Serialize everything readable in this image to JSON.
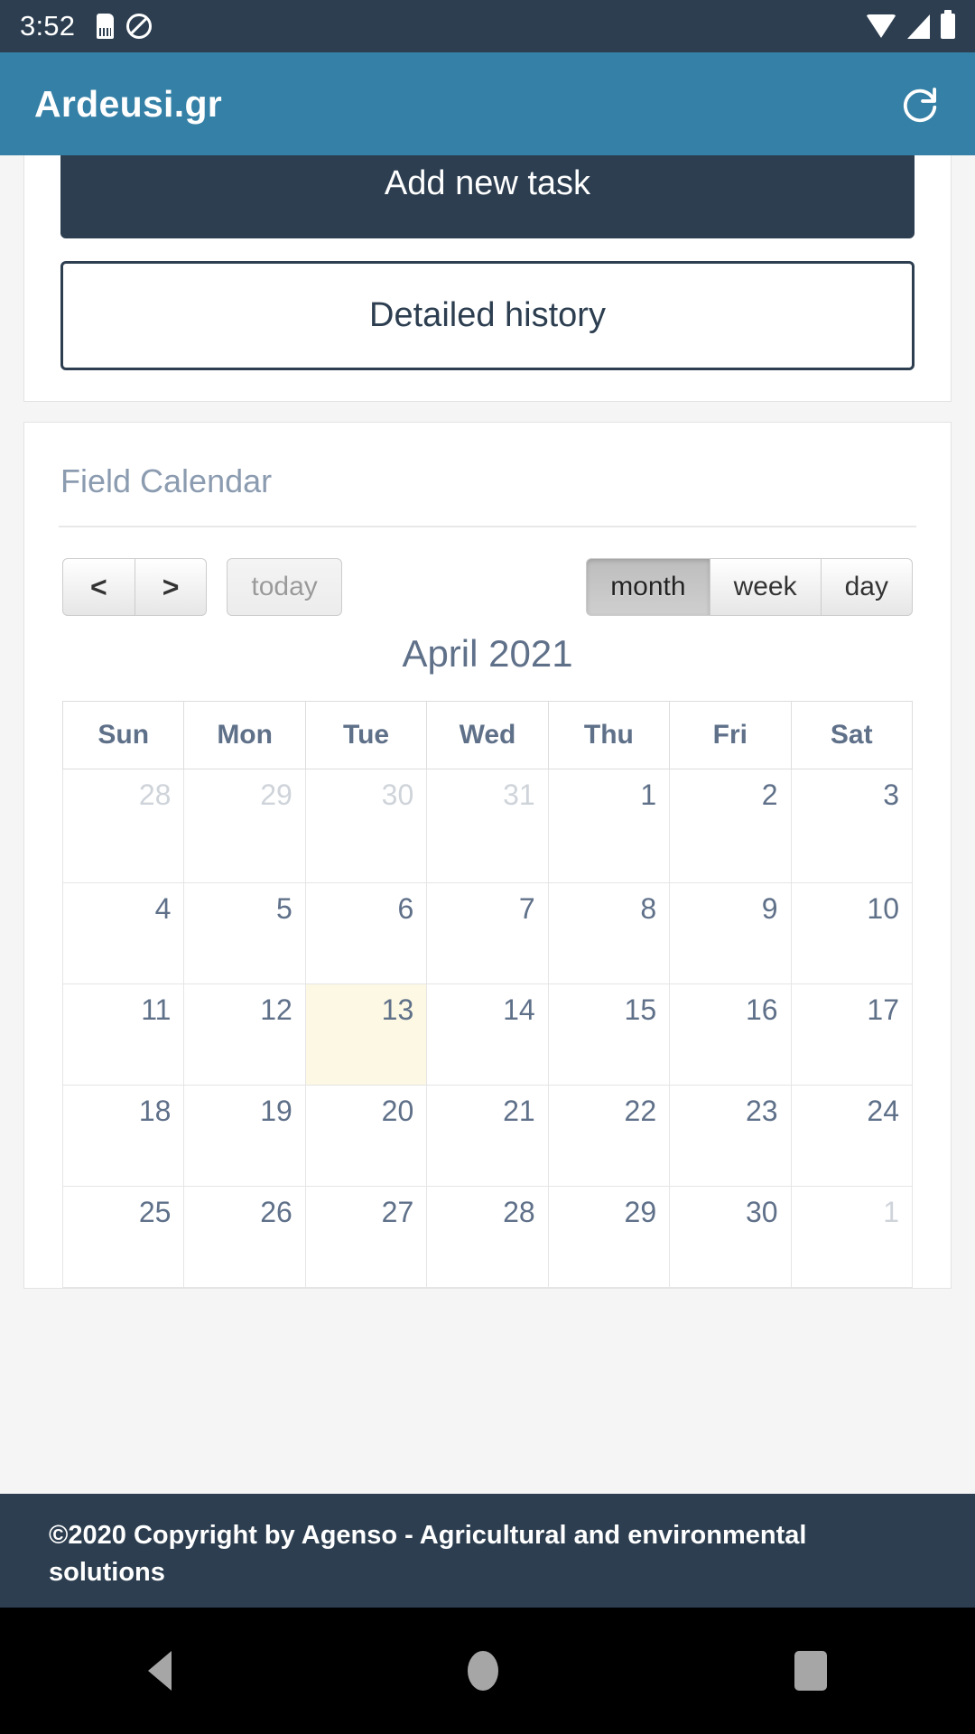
{
  "statusbar": {
    "time": "3:52",
    "icons_left": [
      "sdcard-icon",
      "do-not-disturb-icon"
    ],
    "icons_right": [
      "wifi-icon",
      "cellular-signal-icon",
      "battery-icon"
    ]
  },
  "appbar": {
    "title": "Ardeusi.gr",
    "refresh_icon": "refresh-icon"
  },
  "actions": {
    "add_task_label": "Add new task",
    "detailed_history_label": "Detailed history"
  },
  "calendar": {
    "heading": "Field Calendar",
    "toolbar": {
      "prev_label": "<",
      "next_label": ">",
      "today_label": "today",
      "views": [
        {
          "label": "month",
          "active": true
        },
        {
          "label": "week",
          "active": false
        },
        {
          "label": "day",
          "active": false
        }
      ]
    },
    "title": "April 2021",
    "weekdays": [
      "Sun",
      "Mon",
      "Tue",
      "Wed",
      "Thu",
      "Fri",
      "Sat"
    ],
    "highlight_color": "#fcf8e3",
    "weeks": [
      [
        {
          "day": "28",
          "other": true
        },
        {
          "day": "29",
          "other": true
        },
        {
          "day": "30",
          "other": true
        },
        {
          "day": "31",
          "other": true
        },
        {
          "day": "1",
          "other": false
        },
        {
          "day": "2",
          "other": false
        },
        {
          "day": "3",
          "other": false
        }
      ],
      [
        {
          "day": "4",
          "other": false
        },
        {
          "day": "5",
          "other": false
        },
        {
          "day": "6",
          "other": false
        },
        {
          "day": "7",
          "other": false
        },
        {
          "day": "8",
          "other": false
        },
        {
          "day": "9",
          "other": false
        },
        {
          "day": "10",
          "other": false
        }
      ],
      [
        {
          "day": "11",
          "other": false
        },
        {
          "day": "12",
          "other": false
        },
        {
          "day": "13",
          "other": false,
          "today": true
        },
        {
          "day": "14",
          "other": false
        },
        {
          "day": "15",
          "other": false
        },
        {
          "day": "16",
          "other": false
        },
        {
          "day": "17",
          "other": false
        }
      ],
      [
        {
          "day": "18",
          "other": false
        },
        {
          "day": "19",
          "other": false
        },
        {
          "day": "20",
          "other": false
        },
        {
          "day": "21",
          "other": false
        },
        {
          "day": "22",
          "other": false
        },
        {
          "day": "23",
          "other": false
        },
        {
          "day": "24",
          "other": false
        }
      ],
      [
        {
          "day": "25",
          "other": false
        },
        {
          "day": "26",
          "other": false
        },
        {
          "day": "27",
          "other": false
        },
        {
          "day": "28",
          "other": false
        },
        {
          "day": "29",
          "other": false
        },
        {
          "day": "30",
          "other": false
        },
        {
          "day": "1",
          "other": true
        }
      ]
    ]
  },
  "footer": {
    "text": "©2020 Copyright by Agenso - Agricultural and environmental solutions"
  },
  "navbar": {
    "back": "back-icon",
    "home": "home-icon",
    "recents": "recents-icon"
  },
  "colors": {
    "appbar": "#3580a6",
    "dark": "#2c3e50",
    "text_slate": "#5f7089"
  }
}
